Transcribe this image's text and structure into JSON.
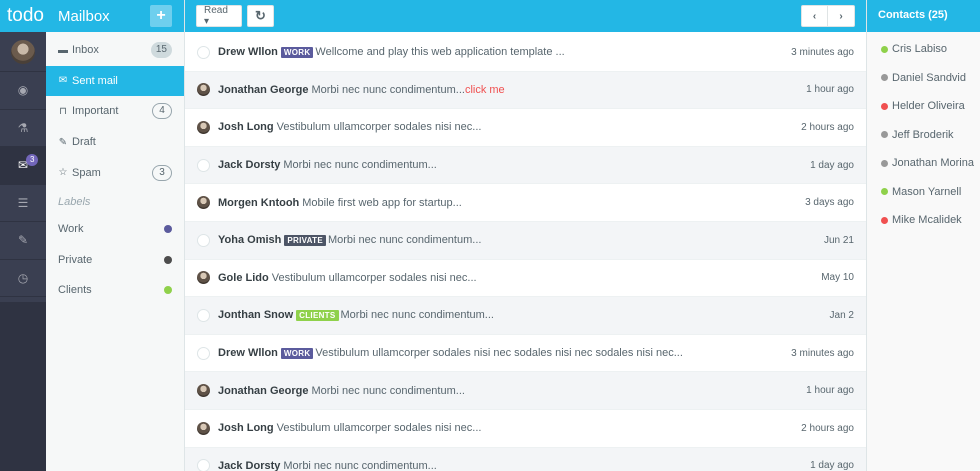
{
  "rail": {
    "brand": "todo",
    "items": [
      {
        "icon": "eye-icon",
        "glyph": "◉"
      },
      {
        "icon": "flask-icon",
        "glyph": "⚗"
      },
      {
        "icon": "envelope-icon",
        "glyph": "✉",
        "badge": "3"
      },
      {
        "icon": "list-icon",
        "glyph": "☰"
      },
      {
        "icon": "pencil-icon",
        "glyph": "✎"
      },
      {
        "icon": "clock-icon",
        "glyph": "◷"
      }
    ]
  },
  "mailbox": {
    "title": "Mailbox",
    "add_label": "+",
    "items": [
      {
        "label": "Inbox",
        "icon": "inbox-icon",
        "glyph": "▬",
        "count": "15",
        "filled": true
      },
      {
        "label": "Sent mail",
        "icon": "envelope-outline-icon",
        "glyph": "✉",
        "count": "",
        "active": true
      },
      {
        "label": "Important",
        "icon": "bookmark-icon",
        "glyph": "⊓",
        "count": "4"
      },
      {
        "label": "Draft",
        "icon": "pencil-icon",
        "glyph": "✎",
        "count": ""
      },
      {
        "label": "Spam",
        "icon": "star-icon",
        "glyph": "☆",
        "count": "3"
      }
    ],
    "labels_heading": "Labels",
    "labels": [
      {
        "label": "Work",
        "color": "#5b5b9d"
      },
      {
        "label": "Private",
        "color": "#4d4d4d"
      },
      {
        "label": "Clients",
        "color": "#8fd14b"
      }
    ]
  },
  "toolbar": {
    "read_label": "Read ▾",
    "refresh_glyph": "↻",
    "prev_glyph": "‹",
    "next_glyph": "›"
  },
  "messages": [
    {
      "name": "Drew Wllon",
      "tag": "WORK",
      "tag_color": "#5b5b9d",
      "text": "Wellcome and play this web application template ...",
      "link": "",
      "time": "3 minutes ago",
      "avatar": "blank"
    },
    {
      "name": "Jonathan George",
      "tag": "",
      "tag_color": "",
      "text": "Morbi nec nunc condimentum...",
      "link": "click me",
      "time": "1 hour ago",
      "avatar": "photo"
    },
    {
      "name": "Josh Long",
      "tag": "",
      "tag_color": "",
      "text": "Vestibulum ullamcorper sodales nisi nec...",
      "link": "",
      "time": "2 hours ago",
      "avatar": "photo"
    },
    {
      "name": "Jack Dorsty",
      "tag": "",
      "tag_color": "",
      "text": "Morbi nec nunc condimentum...",
      "link": "",
      "time": "1 day ago",
      "avatar": "blank"
    },
    {
      "name": "Morgen Kntooh",
      "tag": "",
      "tag_color": "",
      "text": "Mobile first web app for startup...",
      "link": "",
      "time": "3 days ago",
      "avatar": "photo"
    },
    {
      "name": "Yoha Omish",
      "tag": "PRIVATE",
      "tag_color": "#4d5566",
      "text": "Morbi nec nunc condimentum...",
      "link": "",
      "time": "Jun 21",
      "avatar": "blank"
    },
    {
      "name": "Gole Lido",
      "tag": "",
      "tag_color": "",
      "text": "Vestibulum ullamcorper sodales nisi nec...",
      "link": "",
      "time": "May 10",
      "avatar": "photo"
    },
    {
      "name": "Jonthan Snow",
      "tag": "CLIENTS",
      "tag_color": "#8fd14b",
      "text": "Morbi nec nunc condimentum...",
      "link": "",
      "time": "Jan 2",
      "avatar": "blank"
    },
    {
      "name": "Drew Wllon",
      "tag": "WORK",
      "tag_color": "#5b5b9d",
      "text": "Vestibulum ullamcorper sodales nisi nec sodales nisi nec sodales nisi nec...",
      "link": "",
      "time": "3 minutes ago",
      "avatar": "blank"
    },
    {
      "name": "Jonathan George",
      "tag": "",
      "tag_color": "",
      "text": "Morbi nec nunc condimentum...",
      "link": "",
      "time": "1 hour ago",
      "avatar": "photo"
    },
    {
      "name": "Josh Long",
      "tag": "",
      "tag_color": "",
      "text": "Vestibulum ullamcorper sodales nisi nec...",
      "link": "",
      "time": "2 hours ago",
      "avatar": "photo"
    },
    {
      "name": "Jack Dorsty",
      "tag": "",
      "tag_color": "",
      "text": "Morbi nec nunc condimentum...",
      "link": "",
      "time": "1 day ago",
      "avatar": "blank"
    }
  ],
  "contacts": {
    "title": "Contacts (25)",
    "items": [
      {
        "name": "Cris Labiso",
        "status": "#8fd14b"
      },
      {
        "name": "Daniel Sandvid",
        "status": "#999999"
      },
      {
        "name": "Helder Oliveira",
        "status": "#f05050"
      },
      {
        "name": "Jeff Broderik",
        "status": "#999999"
      },
      {
        "name": "Jonathan Morina",
        "status": "#999999"
      },
      {
        "name": "Mason Yarnell",
        "status": "#8fd14b"
      },
      {
        "name": "Mike Mcalidek",
        "status": "#f05050"
      }
    ]
  }
}
